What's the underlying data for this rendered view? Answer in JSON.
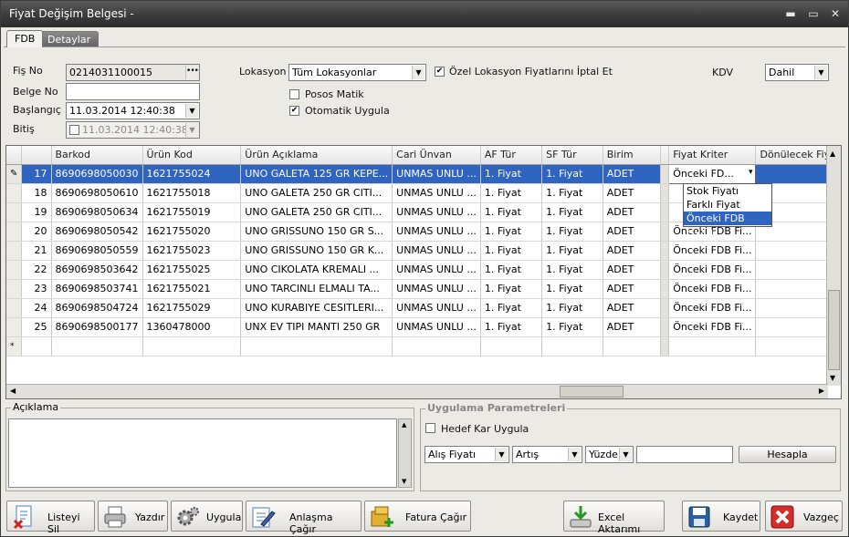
{
  "window": {
    "title": "Fiyat Değişim Belgesi -",
    "minimize_glyph": "▬",
    "restore_glyph": "▭",
    "close_glyph": "✕"
  },
  "tabs": [
    {
      "label": "FDB"
    },
    {
      "label": "Detaylar"
    }
  ],
  "header": {
    "fis_no_label": "Fiş No",
    "fis_no_value": "0214031100015",
    "belge_no_label": "Belge No",
    "belge_no_value": "",
    "baslangic_label": "Başlangıç",
    "baslangic_value": "11.03.2014 12:40:38",
    "bitis_label": "Bitiş",
    "bitis_value": "11.03.2014 12:40:38",
    "lokasyon_label": "Lokasyon",
    "lokasyon_value": "Tüm Lokasyonlar",
    "ozel_lokasyon_label": "Özel Lokasyon Fiyatlarını İptal Et",
    "ozel_lokasyon_checked": true,
    "posos_matik_label": "Posos Matik",
    "posos_matik_checked": false,
    "otomatik_uygula_label": "Otomatik Uygula",
    "otomatik_uygula_checked": true,
    "kdv_label": "KDV",
    "kdv_value": "Dahil"
  },
  "grid": {
    "columns": [
      "",
      "",
      "Barkod",
      "Ürün Kod",
      "Ürün Açıklama",
      "Cari Ünvan",
      "AF Tür",
      "SF Tür",
      "Birim",
      "",
      "Fiyat Kriter",
      "Dönülecek Fiya"
    ],
    "rows": [
      {
        "no": "17",
        "barkod": "8690698050030",
        "urun_kod": "1621755024",
        "aciklama": "UNO GALETA 125 GR KEPE...",
        "cari": "UNMAS UNLU ...",
        "af": "1. Fiyat",
        "sf": "1. Fiyat",
        "birim": "ADET",
        "kriter": "Önceki FD...",
        "selected": true
      },
      {
        "no": "18",
        "barkod": "8690698050610",
        "urun_kod": "1621755018",
        "aciklama": "UNO GALETA 250 GR CITI...",
        "cari": "UNMAS UNLU ...",
        "af": "1. Fiyat",
        "sf": "1. Fiyat",
        "birim": "ADET",
        "kriter": ""
      },
      {
        "no": "19",
        "barkod": "8690698050634",
        "urun_kod": "1621755019",
        "aciklama": "UNO  GALETA 250 GR CITI...",
        "cari": "UNMAS UNLU ...",
        "af": "1. Fiyat",
        "sf": "1. Fiyat",
        "birim": "ADET",
        "kriter": ""
      },
      {
        "no": "20",
        "barkod": "8690698050542",
        "urun_kod": "1621755020",
        "aciklama": "UNO GRISSUNO 150 GR S...",
        "cari": "UNMAS UNLU ...",
        "af": "1. Fiyat",
        "sf": "1. Fiyat",
        "birim": "ADET",
        "kriter": "Önceki FDB Fi..."
      },
      {
        "no": "21",
        "barkod": "8690698050559",
        "urun_kod": "1621755023",
        "aciklama": "UNO GRISSUNO 150 GR K...",
        "cari": "UNMAS UNLU ...",
        "af": "1. Fiyat",
        "sf": "1. Fiyat",
        "birim": "ADET",
        "kriter": "Önceki FDB Fi..."
      },
      {
        "no": "22",
        "barkod": "8690698503642",
        "urun_kod": "1621755025",
        "aciklama": "UNO CIKOLATA KREMALI ...",
        "cari": "UNMAS UNLU ...",
        "af": "1. Fiyat",
        "sf": "1. Fiyat",
        "birim": "ADET",
        "kriter": "Önceki FDB Fi..."
      },
      {
        "no": "23",
        "barkod": "8690698503741",
        "urun_kod": "1621755021",
        "aciklama": "UNO TARCINLI ELMALI TA...",
        "cari": "UNMAS UNLU ...",
        "af": "1. Fiyat",
        "sf": "1. Fiyat",
        "birim": "ADET",
        "kriter": "Önceki FDB Fi..."
      },
      {
        "no": "24",
        "barkod": "8690698504724",
        "urun_kod": "1621755029",
        "aciklama": "UNO KURABIYE CESITLERI...",
        "cari": "UNMAS UNLU ...",
        "af": "1. Fiyat",
        "sf": "1. Fiyat",
        "birim": "ADET",
        "kriter": "Önceki FDB Fi..."
      },
      {
        "no": "25",
        "barkod": "8690698500177",
        "urun_kod": "1360478000",
        "aciklama": "UNX EV TIPI MANTI 250 GR",
        "cari": "UNMAS UNLU ...",
        "af": "1. Fiyat",
        "sf": "1. Fiyat",
        "birim": "ADET",
        "kriter": "Önceki FDB Fi..."
      }
    ],
    "new_row_glyph": "*",
    "edit_glyph": "✎",
    "dropdown_options": [
      "Stok Fiyatı",
      "Farklı Fiyat",
      "Önceki FDB Fiyatı"
    ],
    "dropdown_highlighted": "Önceki FDB Fiyatı"
  },
  "aciklama": {
    "label": "Açıklama",
    "value": ""
  },
  "params": {
    "title": "Uygulama Parametreleri",
    "hedef_label": "Hedef Kar Uygula",
    "hedef_checked": false,
    "fiyat_select": "Alış Fiyatı",
    "yon_select": "Artış",
    "tip_select": "Yüzde",
    "amount_value": "",
    "hesapla_label": "Hesapla"
  },
  "toolbar": {
    "listeyi_sil": "Listeyi Sil",
    "yazdir": "Yazdır",
    "uygula": "Uygula",
    "anlasma_cagir": "Anlaşma Çağır",
    "fatura_cagir": "Fatura Çağır",
    "excel_aktarimi": "Excel Aktarımı",
    "kaydet": "Kaydet",
    "vazgec": "Vazgeç"
  },
  "colors": {
    "selection": "#2f64c0",
    "titlebar": "#3b3b3b"
  }
}
